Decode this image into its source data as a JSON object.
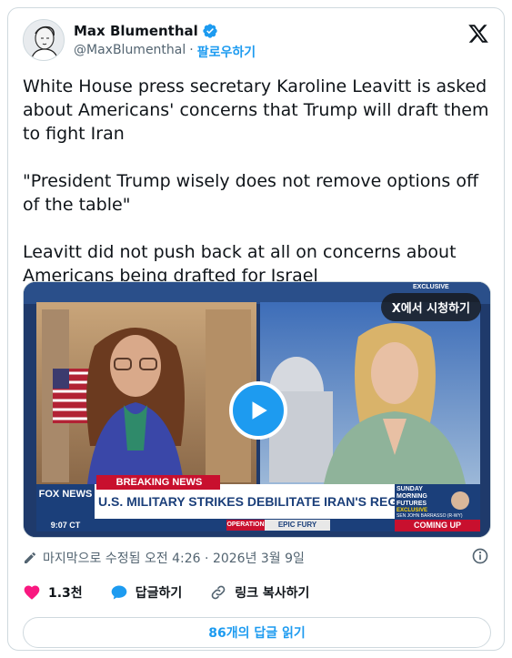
{
  "author": {
    "name": "Max Blumenthal",
    "handle": "@MaxBlumenthal",
    "separator": "·",
    "follow_label": "팔로우하기"
  },
  "tweet": {
    "text": "White House press secretary Karoline Leavitt is asked about Americans' concerns that Trump will draft them to fight Iran\n\n\"President Trump wisely does not remove options off of the table\"\n\nLeavitt did not push back at all on concerns about Americans being drafted for Israel"
  },
  "media": {
    "watch_label": "X에서 시청하기",
    "breaking_news": "BREAKING NEWS",
    "headline": "U.S. MILITARY STRIKES DEBILITATE IRAN'S REGIME",
    "network": "FOX NEWS",
    "time": "9:07 CT",
    "operation": "OPERATION",
    "operation_name": "EPIC FURY",
    "exclusive": "EXCLUSIVE",
    "show_name": "SUNDAY MORNING FUTURES",
    "coming_up_tag": "EXCLUSIVE",
    "coming_up_guest": "SEN JOHN BARRASSO (R-WY)",
    "coming_up": "COMING UP"
  },
  "meta": {
    "edited_text": "마지막으로 수정됨 오전 4:26 · 2026년 3월 9일"
  },
  "actions": {
    "likes": "1.3천",
    "reply_label": "답글하기",
    "copy_link_label": "링크 복사하기"
  },
  "read_replies": "86개의 답글 읽기",
  "colors": {
    "accent": "#1d9bf0",
    "like": "#f91880",
    "breaking_red": "#c8102e"
  },
  "icons": {
    "verified": "verified-badge-icon",
    "x_logo": "x-logo-icon",
    "play": "play-icon",
    "edit": "pencil-icon",
    "info": "info-icon",
    "like": "heart-icon",
    "reply": "speech-bubble-icon",
    "link": "link-icon"
  }
}
